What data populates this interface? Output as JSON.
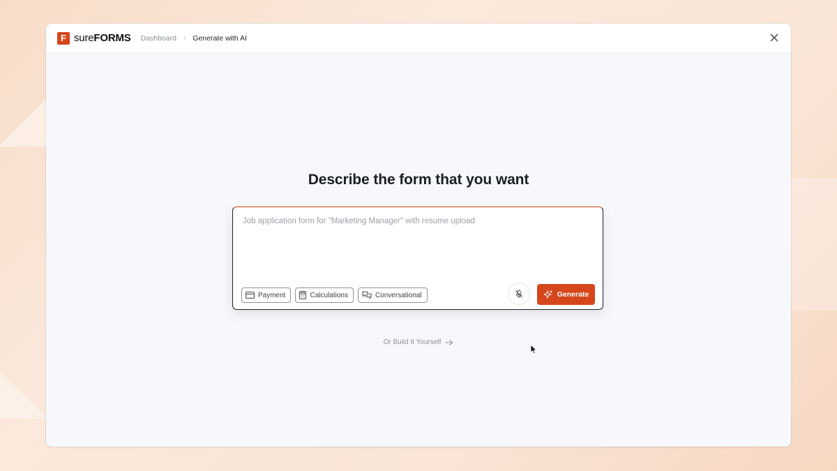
{
  "brand": {
    "prefix": "sure",
    "suffix": "FORMS",
    "mark": "F",
    "accent": "#d5471b"
  },
  "breadcrumb": {
    "items": [
      "Dashboard",
      "Generate with AI"
    ],
    "separator": "›"
  },
  "header": {
    "close_icon": "close-icon"
  },
  "main": {
    "heading": "Describe the form that you want",
    "prompt": {
      "value": "",
      "placeholder": "Job application form for \"Marketing Manager\" with resume upload"
    },
    "chips": [
      {
        "label": "Payment",
        "icon": "credit-card-icon"
      },
      {
        "label": "Calculations",
        "icon": "calculator-icon"
      },
      {
        "label": "Conversational",
        "icon": "chat-bubbles-icon"
      }
    ],
    "mic_icon": "microphone-off-icon",
    "generate_label": "Generate",
    "generate_icon": "sparkle-icon",
    "build_link_label": "Or Build It Yourself",
    "build_link_icon": "arrow-right-icon"
  }
}
